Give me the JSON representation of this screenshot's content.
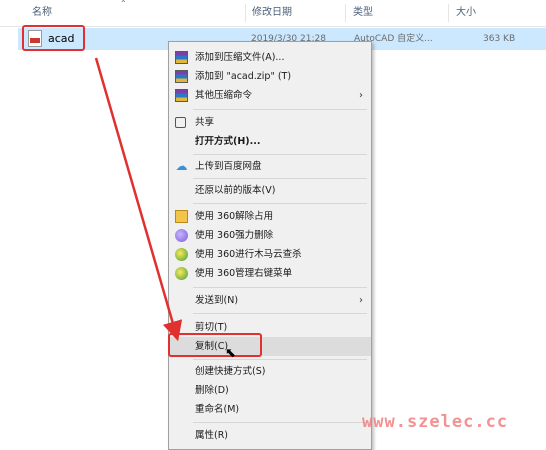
{
  "explorer": {
    "columns": {
      "name": "名称",
      "modified": "修改日期",
      "type": "类型",
      "size": "大小"
    },
    "file": {
      "name": "acad",
      "modified": "2019/3/30 21:28",
      "type": "AutoCAD 自定义...",
      "size": "363 KB"
    }
  },
  "menu": {
    "items": [
      {
        "label": "添加到压缩文件(A)...",
        "icon": "winrar-icon"
      },
      {
        "label": "添加到 \"acad.zip\" (T)",
        "icon": "winrar-icon"
      },
      {
        "label": "其他压缩命令",
        "icon": "winrar-icon",
        "submenu": true
      },
      {
        "label": "共享",
        "icon": "share-icon"
      },
      {
        "label": "打开方式(H)...",
        "bold": true
      },
      {
        "label": "上传到百度网盘",
        "icon": "baidu-cloud-icon"
      },
      {
        "label": "还原以前的版本(V)"
      },
      {
        "label": "使用 360解除占用",
        "icon": "360-unlock-icon"
      },
      {
        "label": "使用 360强力删除",
        "icon": "360-shred-icon"
      },
      {
        "label": "使用 360进行木马云查杀",
        "icon": "360-scan-icon"
      },
      {
        "label": "使用 360管理右键菜单",
        "icon": "360-menu-icon"
      },
      {
        "label": "发送到(N)",
        "submenu": true
      },
      {
        "label": "剪切(T)"
      },
      {
        "label": "复制(C)",
        "highlighted": true
      },
      {
        "label": "创建快捷方式(S)"
      },
      {
        "label": "删除(D)"
      },
      {
        "label": "重命名(M)"
      },
      {
        "label": "属性(R)"
      }
    ],
    "submenu_arrow": "›"
  },
  "annotation_color": "#e0302f",
  "watermark": "www.szelec.cc"
}
